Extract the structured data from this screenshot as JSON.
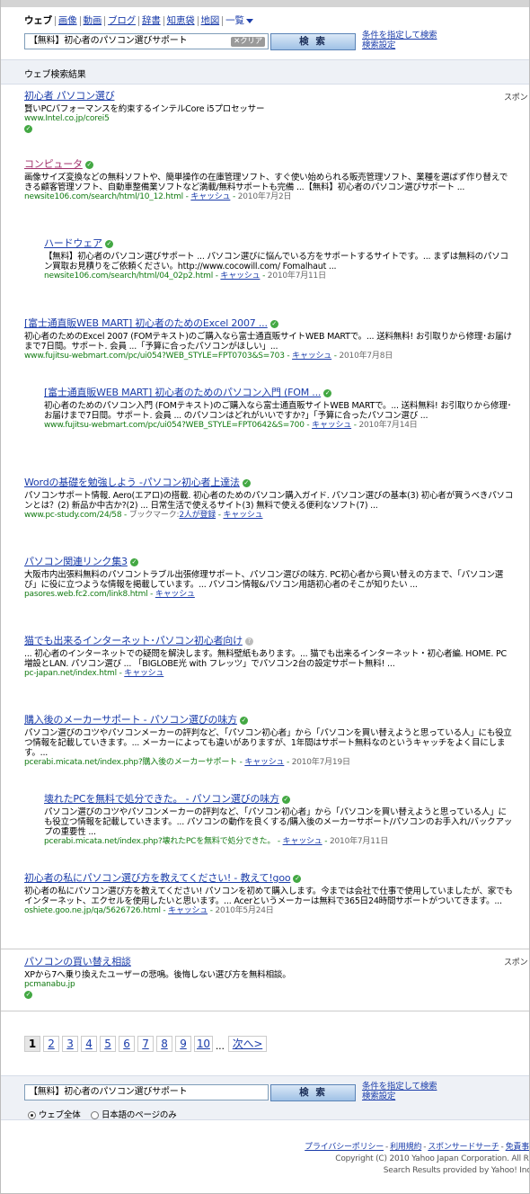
{
  "nav": {
    "tabs": [
      "ウェブ",
      "画像",
      "動画",
      "ブログ",
      "辞書",
      "知恵袋",
      "地図",
      "一覧"
    ]
  },
  "search": {
    "query": "【無料】初心者のパソコン選びサポート",
    "clear_label": "✕クリア",
    "button_label": "検 索",
    "advanced_label": "条件を指定して検索",
    "settings_label": "検索設定"
  },
  "results_header": "ウェブ検索結果",
  "sponsor_label": "スポン",
  "sponsor_top": {
    "title": "初心者 パソコン選び",
    "snippet": "賢いPCパフォーマンスを約束するインテルCore i5プロセッサー",
    "url": "www.Intel.co.jp/corei5"
  },
  "results": [
    {
      "title": "コンピュータ",
      "snippet": "画像サイズ変換などの無料ソフトや、簡単操作の在庫管理ソフト、すぐ使い始められる販売管理ソフト、業種を選ばず作り替えできる顧客管理ソフト、自動車整備業ソフトなど満載/無料サポートも完備 ...【無料】初心者のパソコン選びサポート ...",
      "url": "newsite106.com/search/html/10_12.html",
      "cache": "キャッシュ",
      "date": "2010年7月2日"
    },
    {
      "title": "ハードウェア",
      "snippet": "【無料】初心者のパソコン選びサポート ... パソコン選びに悩んでいる方をサポートするサイトです。... まずは無料のパソコン買取お見積りをご依頼ください。http://www.cocowill.com/ Fomalhaut ...",
      "url": "newsite106.com/search/html/04_02p2.html",
      "cache": "キャッシュ",
      "date": "2010年7月11日"
    },
    {
      "title": "[富士通直販WEB MART] 初心者のためのExcel 2007 ...",
      "snippet": "初心者のためのExcel 2007 (FOMテキスト)のご購入なら富士通直販サイトWEB MARTで。... 送料無料! お引取りから修理･お届けまで7日間。サポート. 会員 ...「予算に合ったパソコンがほしい」...",
      "url": "www.fujitsu-webmart.com/pc/ui054?WEB_STYLE=FPT0703&S=703",
      "cache": "キャッシュ",
      "date": "2010年7月8日"
    },
    {
      "title": "[富士通直販WEB MART] 初心者のためのパソコン入門 (FOM ...",
      "snippet": "初心者のためのパソコン入門 (FOMテキスト)のご購入なら富士通直販サイトWEB MARTで。... 送料無料! お引取りから修理･お届けまで7日間。サポート. 会員 ... のパソコンはどれがいいですか?」「予算に合ったパソコン選び ...",
      "url": "www.fujitsu-webmart.com/pc/ui054?WEB_STYLE=FPT0642&S=700",
      "cache": "キャッシュ",
      "date": "2010年7月14日"
    },
    {
      "title": "Wordの基礎を勉強しよう -パソコン初心者上達法",
      "snippet": "パソコンサポート情報. Aero(エアロ)の搭載. 初心者のためのパソコン購入ガイド. パソコン選びの基本(3) 初心者が買うべきパソコンとは？(2) 新品か中古か?(2) ... 日常生活で使えるサイト(3) 無料で使える便利なソフト(7) ...",
      "url": "www.pc-study.com/24/58",
      "bookmark_label": "ブックマーク:",
      "bookmark_count": "2人が登録",
      "cache": "キャッシュ"
    },
    {
      "title": "パソコン関連リンク集3",
      "snippet": "大阪市内出張料無料のパソコントラブル出張修理サポート、パソコン選びの味方. PC初心者から買い替えの方まで、「パソコン選び」に役に立つような情報を掲載しています。... パソコン情報&パソコン用語初心者のそこが知りたい ...",
      "url": "pasores.web.fc2.com/link8.html",
      "cache": "キャッシュ"
    },
    {
      "title": "猫でも出来るインターネット･パソコン初心者向け",
      "snippet": "... 初心者のインターネットでの疑問を解決します。無料壁紙もあります。... 猫でも出来るインターネット・初心者編. HOME. PC増設とLAN. パソコン選び ... 「BIGLOBE光 with フレッツ」でパソコン2台の設定サポート無料! ...",
      "url": "pc-japan.net/index.html",
      "cache": "キャッシュ"
    },
    {
      "title": "購入後のメーカーサポート - パソコン選びの味方",
      "snippet": "パソコン選びのコツやパソコンメーカーの評判など、「パソコン初心者」から「パソコンを買い替えようと思っている人」にも役立つ情報を記載していきます。... メーカーによっても違いがありますが、1年間はサポート無料なのというキャッチをよく目にします。...",
      "url": "pcerabi.micata.net/index.php?購入後のメーカーサポート",
      "cache": "キャッシュ",
      "date": "2010年7月19日"
    },
    {
      "title": "壊れたPCを無料で処分できた。 - パソコン選びの味方",
      "snippet": "パソコン選びのコツやパソコンメーカーの評判など、「パソコン初心者」から「パソコンを買い替えようと思っている人」にも役立つ情報を記載していきます。... パソコンの動作を良くする/購入後のメーカーサポート/パソコンのお手入れ/バックアップの重要性 ...",
      "url": "pcerabi.micata.net/index.php?壊れたPCを無料で処分できた。",
      "cache": "キャッシュ",
      "date": "2010年7月11日"
    },
    {
      "title": "初心者の私にパソコン選び方を教えてください! - 教えて!goo",
      "snippet": "初心者の私にパソコン選び方を教えてください! パソコンを初めて購入します。今までは会社で仕事で使用していましたが、家でもインターネット、エクセルを使用したいと思います。... Acerというメーカーは無料で365日24時間サポートがついてきます。...",
      "url": "oshiete.goo.ne.jp/qa/5626726.html",
      "cache": "キャッシュ",
      "date": "2010年5月24日"
    }
  ],
  "sponsor_bottom": {
    "title": "パソコンの買い替え相談",
    "snippet": "XPから7へ乗り換えたユーザーの悲鳴。後悔しない選び方を無料相談。",
    "url": "pcmanabu.jp"
  },
  "pager": {
    "pages": [
      "1",
      "2",
      "3",
      "4",
      "5",
      "6",
      "7",
      "8",
      "9",
      "10"
    ],
    "ellipsis": "...",
    "next": "次へ>"
  },
  "bottom_search": {
    "query": "【無料】初心者のパソコン選びサポート",
    "button_label": "検 索",
    "advanced_label": "条件を指定して検索",
    "settings_label": "検索設定",
    "radio_all": "ウェブ全体",
    "radio_jp": "日本語のページのみ"
  },
  "footer": {
    "links": [
      "プライバシーポリシー",
      "利用規約",
      "スポンサードサーチ",
      "免責事"
    ],
    "copyright": "Copyright (C) 2010 Yahoo Japan Corporation. All Ri",
    "provided": "Search Results provided by Yahoo! Inc"
  }
}
